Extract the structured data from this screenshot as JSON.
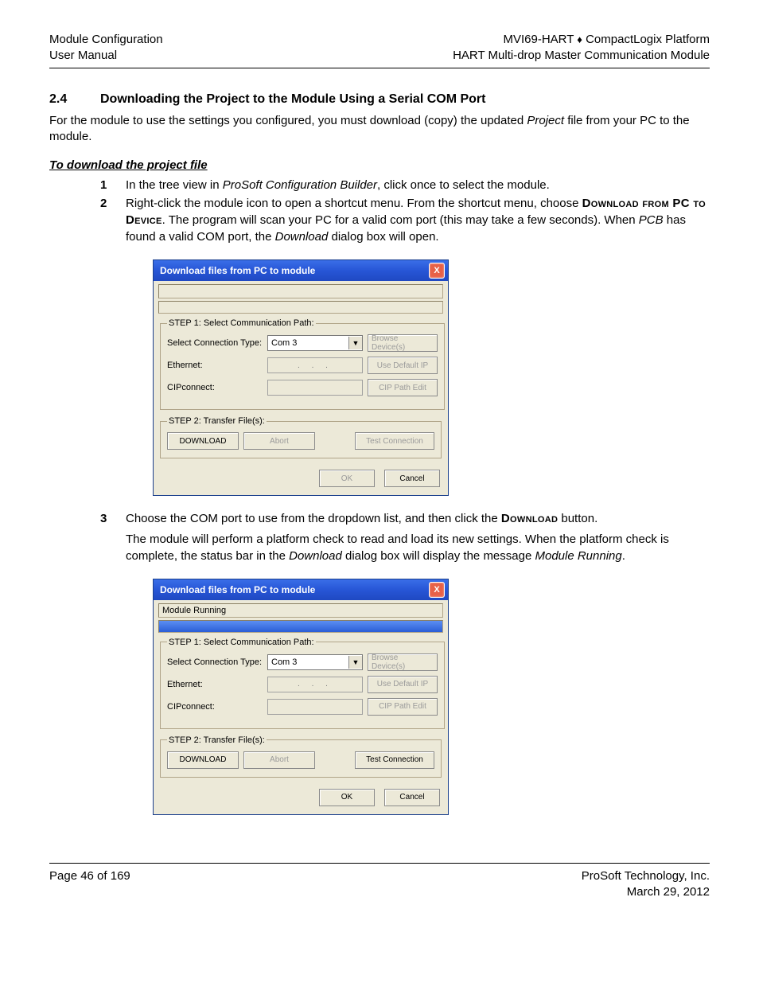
{
  "header": {
    "left1": "Module Configuration",
    "left2": "User Manual",
    "right1_a": "MVI69-HART ",
    "right1_diamond": "♦",
    "right1_b": " CompactLogix Platform",
    "right2": "HART Multi-drop Master Communication Module"
  },
  "section": {
    "num": "2.4",
    "title": "Downloading the Project to the Module Using a Serial COM Port",
    "intro_a": "For the module to use the settings you configured, you must download (copy) the updated ",
    "intro_i": "Project",
    "intro_b": " file from your PC to the module.",
    "subhead": "To download the project file",
    "step1_a": "In the tree view in ",
    "step1_i": "ProSoft Configuration Builder",
    "step1_b": ", click once to select the module.",
    "step2_a": "Right-click the module icon to open a shortcut menu. From the shortcut menu, choose ",
    "step2_sc1": "Download from PC to Device",
    "step2_b": ". The program will scan your PC for a valid com port (this may take a few seconds). When ",
    "step2_i": "PCB",
    "step2_c": " has found a valid COM port, the ",
    "step2_i2": "Download",
    "step2_d": " dialog box will open.",
    "step3_a": "Choose the COM port to use from the dropdown list, and then click the ",
    "step3_sc": "Download",
    "step3_b": " button.",
    "post3_a": "The module will perform a platform check to read and load its new settings. When the platform check is complete, the status bar in the ",
    "post3_i": "Download",
    "post3_b": " dialog box will display the message ",
    "post3_i2": "Module Running",
    "post3_c": "."
  },
  "dialog": {
    "title": "Download files from PC to module",
    "close": "X",
    "status_running": "Module Running",
    "step1_legend": "STEP 1: Select Communication Path:",
    "lbl_conn_type": "Select Connection Type:",
    "combo_value": "Com 3",
    "btn_browse": "Browse Device(s)",
    "lbl_ethernet": "Ethernet:",
    "eth_value": ". . .",
    "btn_default_ip": "Use Default IP",
    "lbl_cip": "CIPconnect:",
    "btn_cip": "CIP Path Edit",
    "step2_legend": "STEP 2: Transfer File(s):",
    "btn_download": "DOWNLOAD",
    "btn_abort": "Abort",
    "btn_test": "Test Connection",
    "btn_ok": "OK",
    "btn_cancel": "Cancel"
  },
  "footer": {
    "left": "Page 46 of 169",
    "right1": "ProSoft Technology, Inc.",
    "right2": "March 29, 2012"
  }
}
